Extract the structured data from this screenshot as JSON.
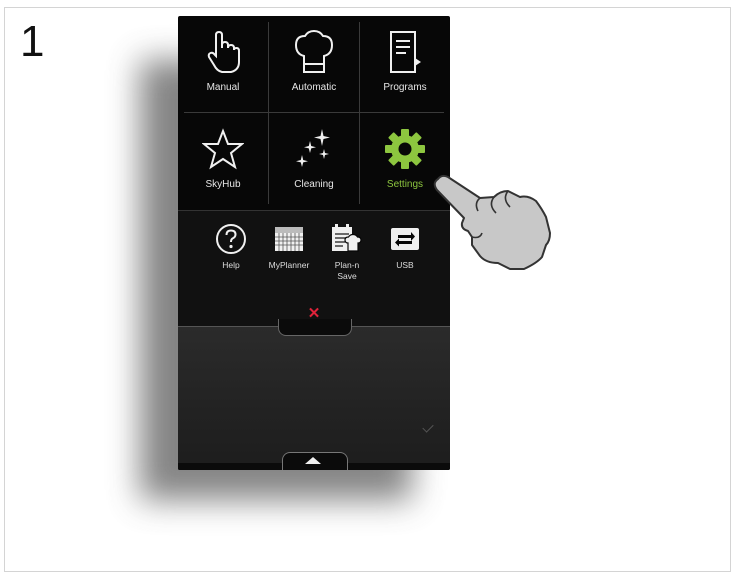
{
  "step_number": "1",
  "main_tiles": [
    {
      "label": "Manual",
      "icon": "pointing-hand-icon"
    },
    {
      "label": "Automatic",
      "icon": "chef-hat-icon"
    },
    {
      "label": "Programs",
      "icon": "recipe-book-icon"
    },
    {
      "label": "SkyHub",
      "icon": "star-icon"
    },
    {
      "label": "Cleaning",
      "icon": "sparkle-icon"
    },
    {
      "label": "Settings",
      "icon": "gear-icon"
    }
  ],
  "utility_items": [
    {
      "label": "Help",
      "icon": "help-icon"
    },
    {
      "label": "MyPlanner",
      "icon": "calendar-icon"
    },
    {
      "label": "Plan-n\nSave",
      "icon": "plan-n-save-icon"
    },
    {
      "label": "USB",
      "icon": "usb-transfer-icon"
    }
  ],
  "colors": {
    "accent_green": "#8dc63f",
    "close_red": "#e0233a",
    "device_bg": "#070707"
  }
}
